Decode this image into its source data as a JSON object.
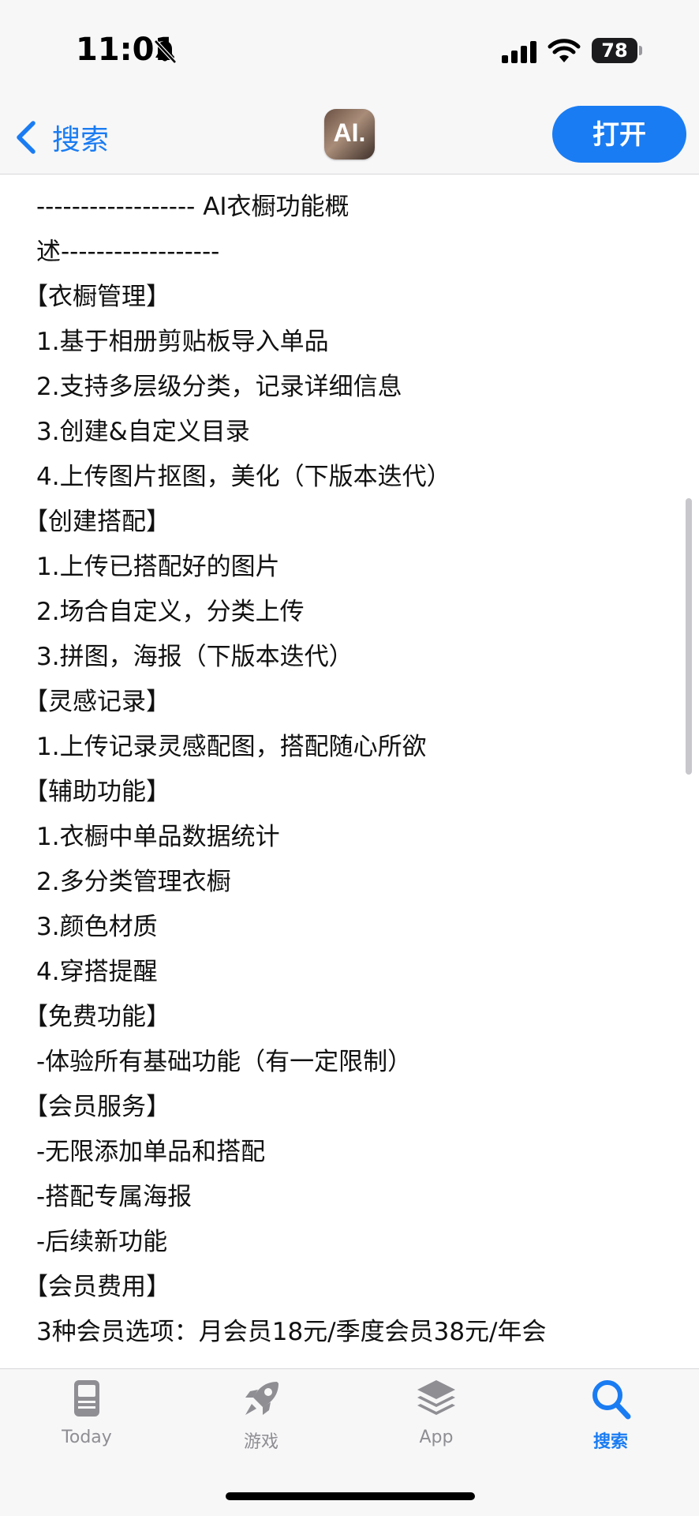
{
  "status_bar": {
    "time": "11:01",
    "battery": "78",
    "icons": [
      "bell-muted-icon",
      "signal-icon",
      "wifi-icon",
      "battery-icon"
    ]
  },
  "nav": {
    "back_label": "搜索",
    "app_icon_text": "AI.",
    "open_label": "打开"
  },
  "description": {
    "lines": [
      "------------------ AI衣橱功能概",
      "述------------------",
      "【衣橱管理】",
      "1.基于相册剪贴板导入单品",
      "2.支持多层级分类，记录详细信息",
      "3.创建&自定义目录",
      "4.上传图片抠图，美化（下版本迭代）",
      "【创建搭配】",
      "1.上传已搭配好的图片",
      "2.场合自定义，分类上传",
      "3.拼图，海报（下版本迭代）",
      "【灵感记录】",
      "1.上传记录灵感配图，搭配随心所欲",
      "【辅助功能】",
      "1.衣橱中单品数据统计",
      "2.多分类管理衣橱",
      "3.颜色材质",
      "4.穿搭提醒",
      "【免费功能】",
      "-体验所有基础功能（有一定限制）",
      "【会员服务】",
      "-无限添加单品和搭配",
      "-搭配专属海报",
      "-后续新功能",
      "【会员费用】",
      "3种会员选项：月会员18元/季度会员38元/年会"
    ]
  },
  "tabs": [
    {
      "label": "Today",
      "icon": "today-icon"
    },
    {
      "label": "游戏",
      "icon": "rocket-icon"
    },
    {
      "label": "App",
      "icon": "app-stack-icon"
    },
    {
      "label": "搜索",
      "icon": "search-icon"
    }
  ],
  "colors": {
    "accent": "#1a7cf2",
    "inactive": "#8e8e93"
  }
}
